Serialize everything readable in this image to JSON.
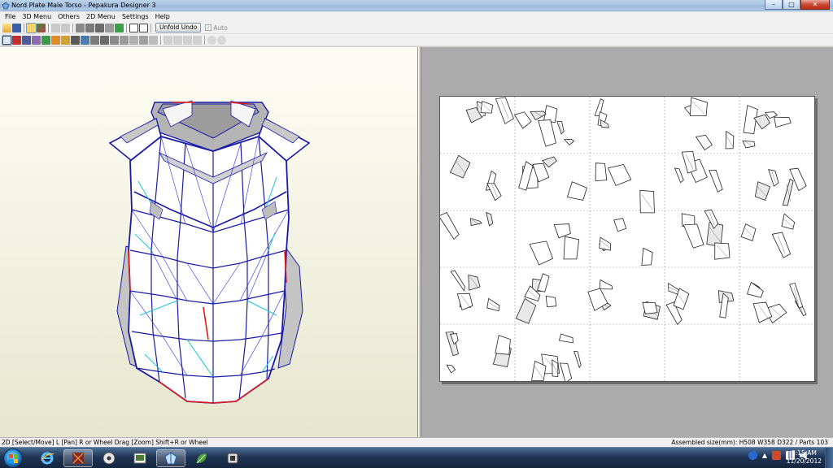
{
  "window": {
    "title": "Nord Plate Male Torso - Pepakura Designer 3",
    "controls": {
      "minimize": "–",
      "maximize": "□",
      "close": "✕"
    }
  },
  "menu": {
    "items": [
      "File",
      "3D Menu",
      "Others",
      "2D Menu",
      "Settings",
      "Help"
    ]
  },
  "toolbar": {
    "unfold_undo_label": "Unfold Undo",
    "auto_label": "Auto",
    "auto_checked": true
  },
  "status": {
    "left": "2D [Select/Move] L [Pan] R or Wheel Drag [Zoom] Shift+R or Wheel",
    "right": "Assembled size(mm): H508 W358 D322 / Parts 103"
  },
  "taskbar": {
    "time": "3:15 AM",
    "date": "11/20/2012",
    "apps": [
      "internet-explorer-icon",
      "graphics-app-icon",
      "media-app-icon",
      "image-app-icon",
      "pepakura-icon",
      "leaf-app-icon",
      "device-app-icon"
    ]
  },
  "colors": {
    "titlebar": "#a7c2e0",
    "view3d_bg": "#f0f0de",
    "view2d_bg": "#ababab",
    "model_edge": "#1a1aa8",
    "cut_edge": "#e01a1a",
    "fold_edge": "#18c8d8",
    "taskbar": "#1f3555"
  },
  "paper_layout": {
    "columns": 5,
    "rows": 5,
    "filled_pages": 22
  }
}
